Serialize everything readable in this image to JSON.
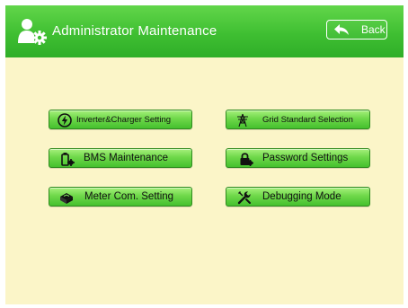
{
  "header": {
    "title": "Administrator Maintenance",
    "back_label": "Back",
    "icon": "admin-user-gear-icon"
  },
  "menu": {
    "items": [
      {
        "label": "Inverter&Charger Setting",
        "icon": "lightning-bolt-icon"
      },
      {
        "label": "Grid Standard Selection",
        "icon": "power-tower-icon"
      },
      {
        "label": "BMS Maintenance",
        "icon": "battery-gear-icon"
      },
      {
        "label": "Password Settings",
        "icon": "lock-gear-icon"
      },
      {
        "label": "Meter Com. Setting",
        "icon": "meter-box-icon"
      },
      {
        "label": "Debugging Mode",
        "icon": "wrench-icon"
      }
    ]
  },
  "colors": {
    "header_green": "#3fbf32",
    "background": "#fbf5c8",
    "button_green": "#6fd84a"
  }
}
